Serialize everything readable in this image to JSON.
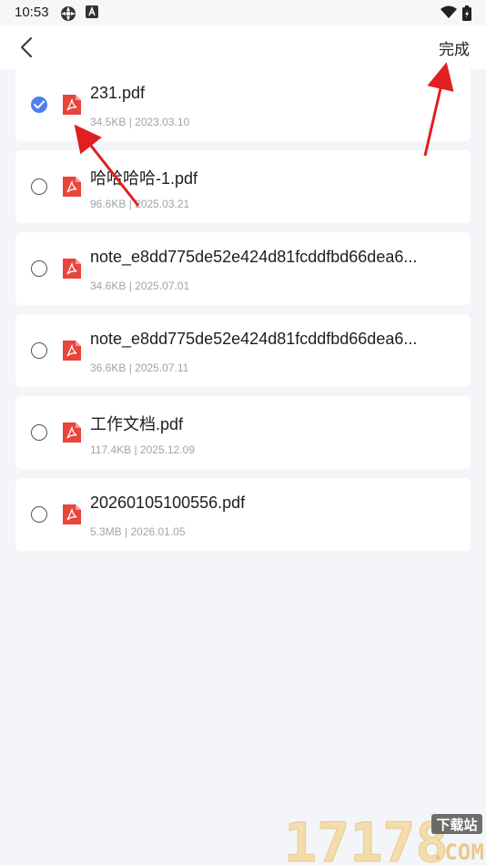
{
  "status_bar": {
    "time": "10:53"
  },
  "nav": {
    "done_label": "完成"
  },
  "files": [
    {
      "name": "231.pdf",
      "meta": "34.5KB | 2023.03.10",
      "selected": true
    },
    {
      "name": "哈哈哈哈-1.pdf",
      "meta": "96.6KB | 2025.03.21",
      "selected": false
    },
    {
      "name": "note_e8dd775de52e424d81fcddfbd66dea6...",
      "meta": "34.6KB | 2025.07.01",
      "selected": false
    },
    {
      "name": "note_e8dd775de52e424d81fcddfbd66dea6...",
      "meta": "36.6KB | 2025.07.11",
      "selected": false
    },
    {
      "name": "工作文档.pdf",
      "meta": "117.4KB | 2025.12.09",
      "selected": false
    },
    {
      "name": "20260105100556.pdf",
      "meta": "5.3MB | 2026.01.05",
      "selected": false
    }
  ],
  "colors": {
    "accent": "#4d7ff0",
    "pdf_red": "#e8453c",
    "annotation": "#e02020"
  },
  "watermark": {
    "number": "17178",
    "tag": "下载站",
    "suffix": ".COM"
  }
}
